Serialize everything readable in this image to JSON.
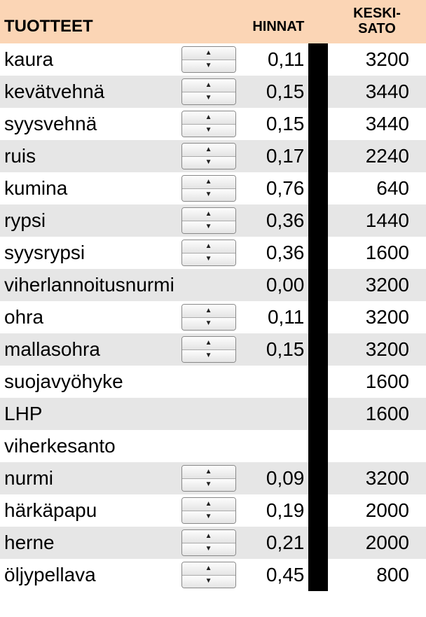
{
  "headers": {
    "tuotteet": "TUOTTEET",
    "hinnat": "HINNAT",
    "keski_sato_line1": "KESKI-",
    "keski_sato_line2": "SATO"
  },
  "rows": [
    {
      "name": "kaura",
      "spinner": true,
      "price": "0,11",
      "sato": "3200"
    },
    {
      "name": "kevätvehnä",
      "spinner": true,
      "price": "0,15",
      "sato": "3440"
    },
    {
      "name": "syysvehnä",
      "spinner": true,
      "price": "0,15",
      "sato": "3440"
    },
    {
      "name": "ruis",
      "spinner": true,
      "price": "0,17",
      "sato": "2240"
    },
    {
      "name": "kumina",
      "spinner": true,
      "price": "0,76",
      "sato": "640"
    },
    {
      "name": "rypsi",
      "spinner": true,
      "price": "0,36",
      "sato": "1440"
    },
    {
      "name": "syysrypsi",
      "spinner": true,
      "price": "0,36",
      "sato": "1600"
    },
    {
      "name": "viherlannoitusnurmi",
      "spinner": false,
      "price": "0,00",
      "sato": "3200"
    },
    {
      "name": "ohra",
      "spinner": true,
      "price": "0,11",
      "sato": "3200"
    },
    {
      "name": "mallasohra",
      "spinner": true,
      "price": "0,15",
      "sato": "3200"
    },
    {
      "name": "suojavyöhyke",
      "spinner": false,
      "price": "",
      "sato": "1600"
    },
    {
      "name": "LHP",
      "spinner": false,
      "price": "",
      "sato": "1600"
    },
    {
      "name": "viherkesanto",
      "spinner": false,
      "price": "",
      "sato": ""
    },
    {
      "name": "nurmi",
      "spinner": true,
      "price": "0,09",
      "sato": "3200"
    },
    {
      "name": "härkäpapu",
      "spinner": true,
      "price": "0,19",
      "sato": "2000"
    },
    {
      "name": "herne",
      "spinner": true,
      "price": "0,21",
      "sato": "2000"
    },
    {
      "name": "öljypellava",
      "spinner": true,
      "price": "0,45",
      "sato": "800"
    }
  ]
}
